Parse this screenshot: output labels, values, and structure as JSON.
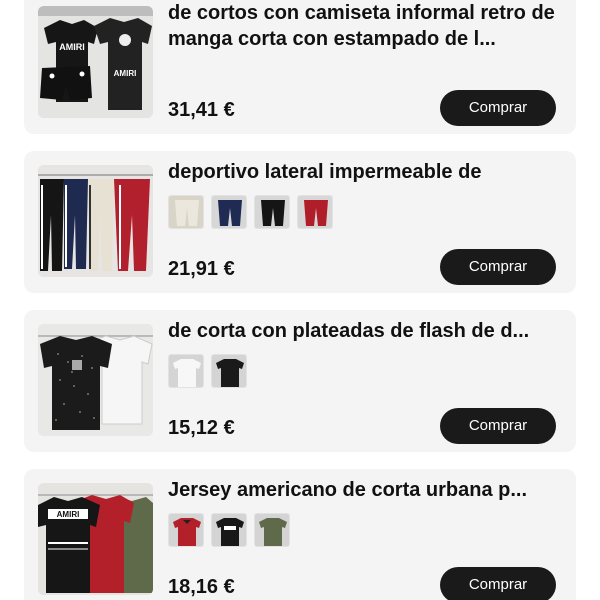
{
  "products": [
    {
      "title": "de cortos con camiseta informal retro de manga corta con estampado de l...",
      "price": "31,41 €",
      "button": "Comprar",
      "image_icon": "black-tshirt-shorts-set",
      "swatches": []
    },
    {
      "title": "deportivo lateral impermeable de",
      "price": "21,91 €",
      "button": "Comprar",
      "image_icon": "track-pants",
      "swatches": [
        "beige-pants",
        "navy-pants",
        "black-pants",
        "red-pants"
      ]
    },
    {
      "title": "de corta con plateadas de flash de d...",
      "price": "15,12 €",
      "button": "Comprar",
      "image_icon": "rhinestone-tshirts",
      "swatches": [
        "white-tshirt",
        "black-tshirt"
      ]
    },
    {
      "title": "Jersey americano de corta urbana p...",
      "price": "18,16 €",
      "button": "Comprar",
      "image_icon": "jersey-shirts",
      "swatches": [
        "red-jersey",
        "black-jersey",
        "olive-jersey"
      ]
    }
  ],
  "colors": {
    "card_bg": "#f4f4f4",
    "button_bg": "#1a1a1a",
    "button_text": "#ffffff",
    "text": "#111111"
  }
}
